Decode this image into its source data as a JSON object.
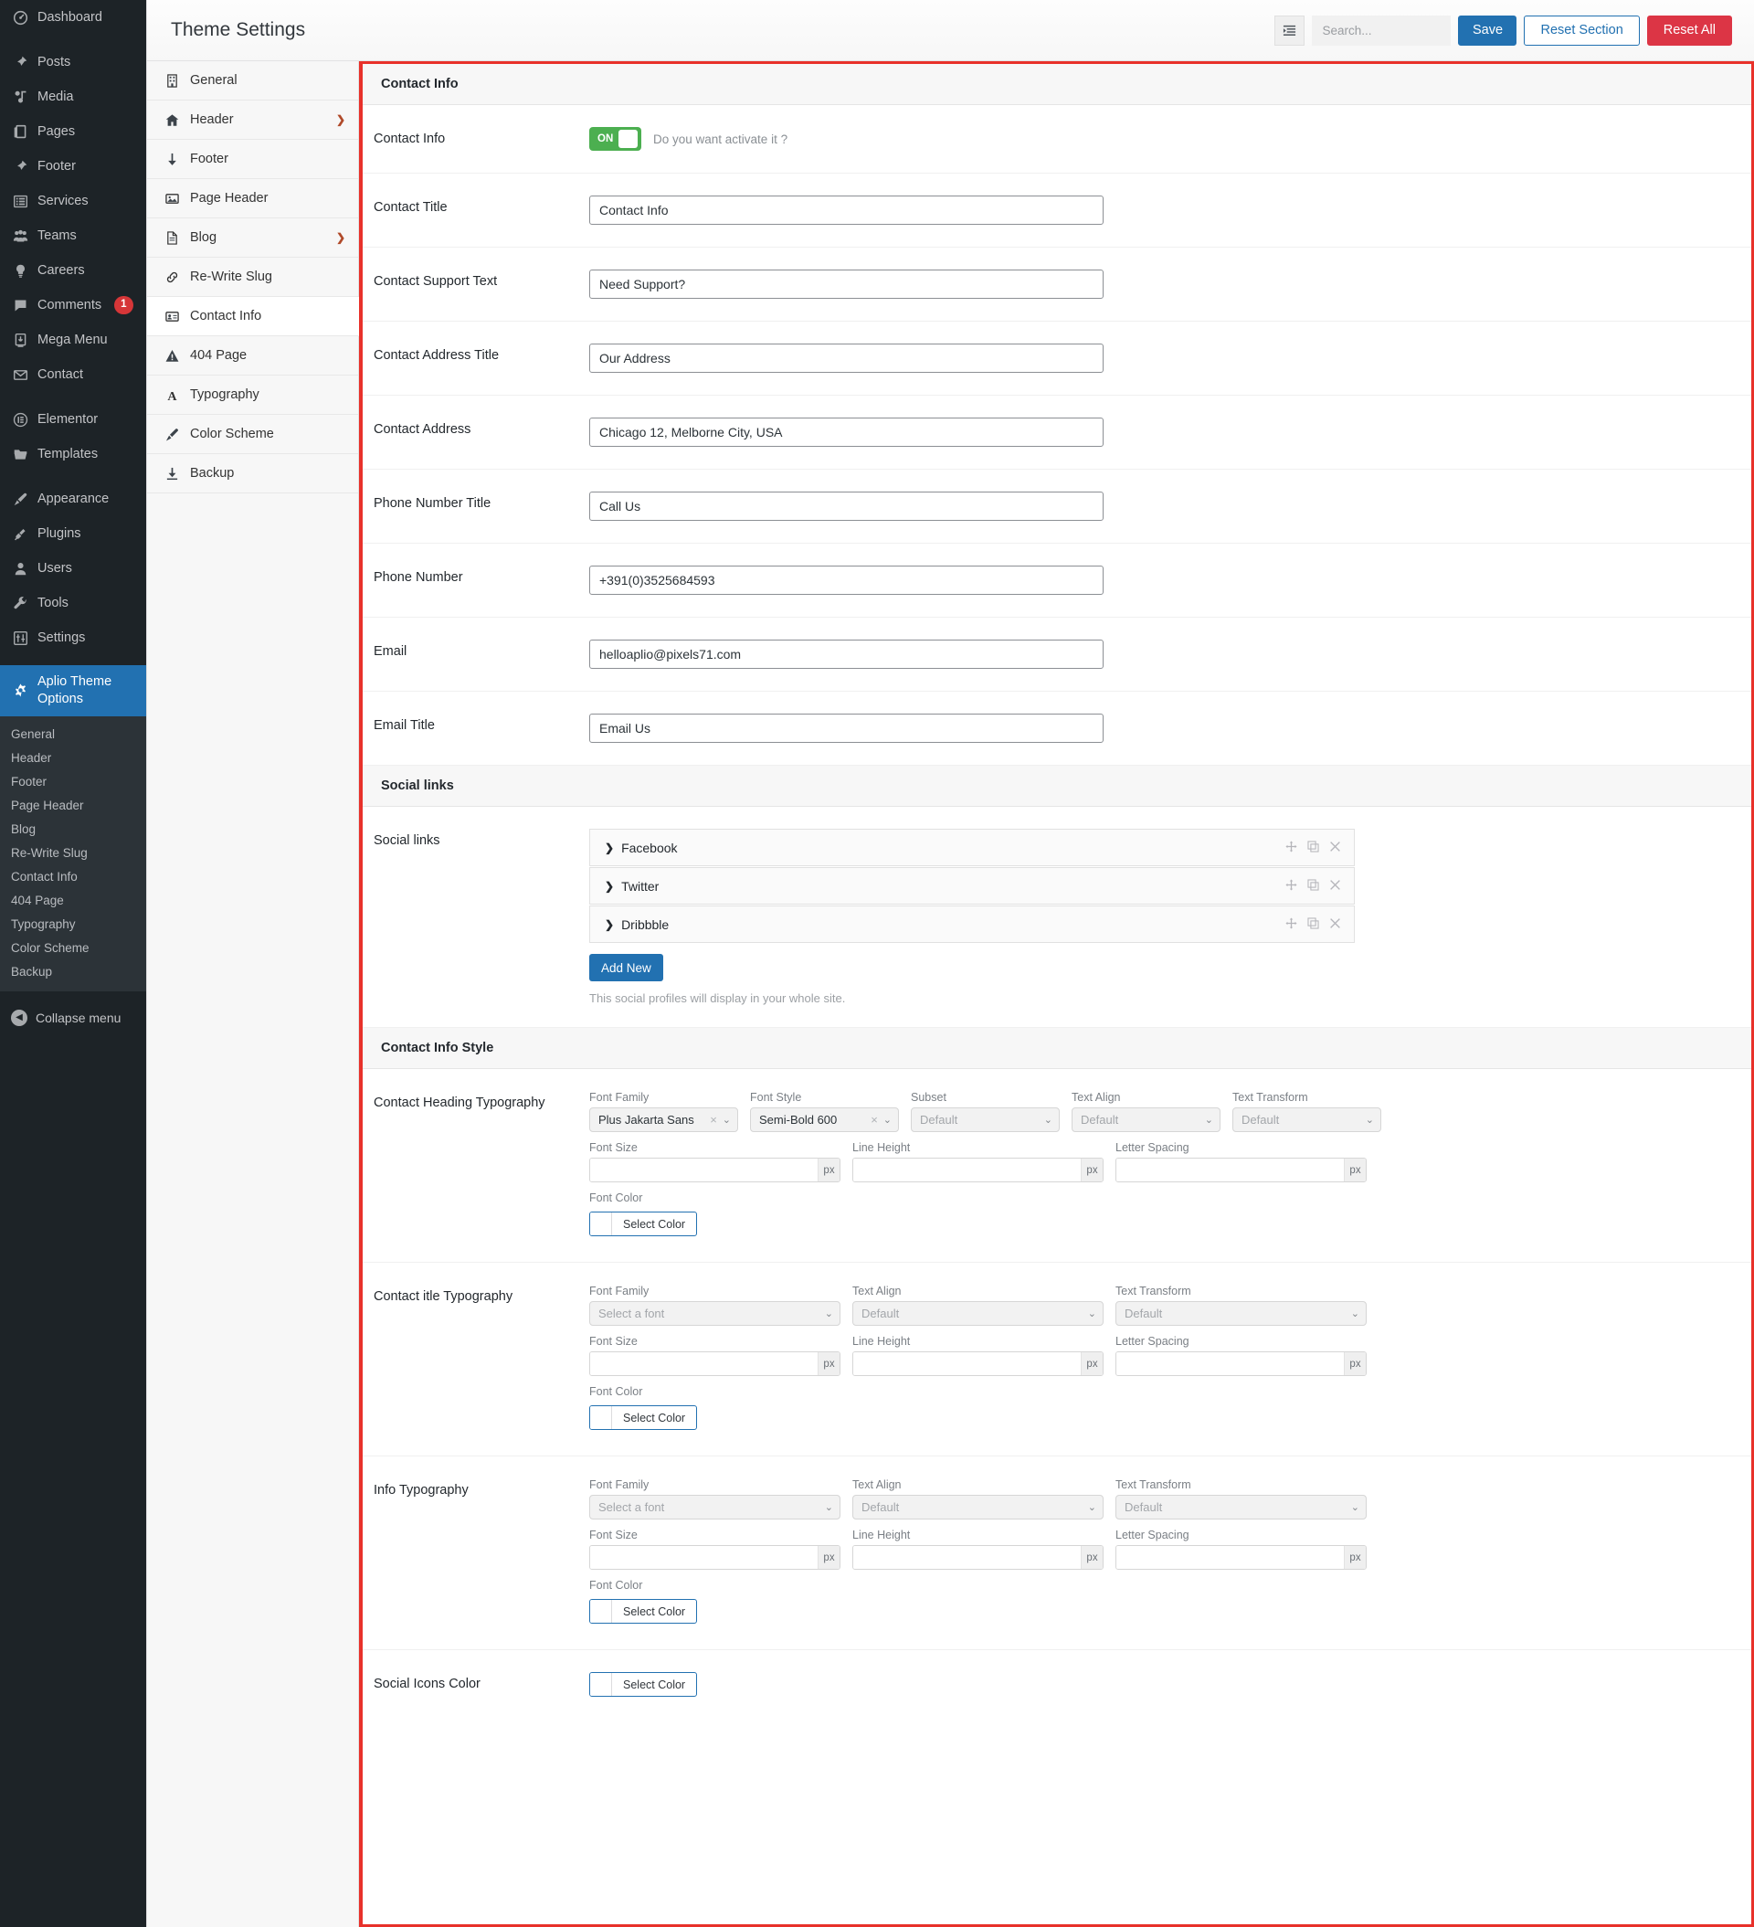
{
  "wp_sidebar": {
    "items": [
      {
        "label": "Dashboard",
        "icon": "dashboard-icon"
      },
      {
        "label": "Posts",
        "icon": "pin-icon",
        "gap_before": true
      },
      {
        "label": "Media",
        "icon": "media-icon"
      },
      {
        "label": "Pages",
        "icon": "pages-icon"
      },
      {
        "label": "Footer",
        "icon": "pin-icon"
      },
      {
        "label": "Services",
        "icon": "list-icon"
      },
      {
        "label": "Teams",
        "icon": "users-group-icon"
      },
      {
        "label": "Careers",
        "icon": "lightbulb-icon"
      },
      {
        "label": "Comments",
        "icon": "comment-icon",
        "badge": "1"
      },
      {
        "label": "Mega Menu",
        "icon": "download-box-icon"
      },
      {
        "label": "Contact",
        "icon": "envelope-icon"
      },
      {
        "label": "Elementor",
        "icon": "elementor-icon",
        "gap_before": true
      },
      {
        "label": "Templates",
        "icon": "folder-icon"
      },
      {
        "label": "Appearance",
        "icon": "brush-icon",
        "gap_before": true
      },
      {
        "label": "Plugins",
        "icon": "plug-icon"
      },
      {
        "label": "Users",
        "icon": "user-icon"
      },
      {
        "label": "Tools",
        "icon": "wrench-icon"
      },
      {
        "label": "Settings",
        "icon": "sliders-icon"
      },
      {
        "label": "Aplio Theme Options",
        "icon": "gear-icon",
        "active": true,
        "gap_before": true
      }
    ],
    "submenu": [
      "General",
      "Header",
      "Footer",
      "Page Header",
      "Blog",
      "Re-Write Slug",
      "Contact Info",
      "404 Page",
      "Typography",
      "Color Scheme",
      "Backup"
    ],
    "collapse_label": "Collapse menu"
  },
  "topbar": {
    "title": "Theme Settings",
    "search_placeholder": "Search...",
    "save_label": "Save",
    "reset_section_label": "Reset Section",
    "reset_all_label": "Reset All"
  },
  "options_nav": [
    {
      "label": "General",
      "icon": "building-icon",
      "chevron": false,
      "active": false
    },
    {
      "label": "Header",
      "icon": "home-icon",
      "chevron": true,
      "active": false
    },
    {
      "label": "Footer",
      "icon": "arrow-down-icon",
      "chevron": false,
      "active": false
    },
    {
      "label": "Page Header",
      "icon": "image-icon",
      "chevron": false,
      "active": false
    },
    {
      "label": "Blog",
      "icon": "document-icon",
      "chevron": true,
      "active": false
    },
    {
      "label": "Re-Write Slug",
      "icon": "link-icon",
      "chevron": false,
      "active": false
    },
    {
      "label": "Contact Info",
      "icon": "id-card-icon",
      "chevron": false,
      "active": true
    },
    {
      "label": "404 Page",
      "icon": "warning-icon",
      "chevron": false,
      "active": false
    },
    {
      "label": "Typography",
      "icon": "letter-a-icon",
      "chevron": false,
      "active": false
    },
    {
      "label": "Color Scheme",
      "icon": "paintbrush-icon",
      "chevron": false,
      "active": false
    },
    {
      "label": "Backup",
      "icon": "download-icon",
      "chevron": false,
      "active": false
    }
  ],
  "sections": {
    "contact_info_heading": "Contact Info",
    "social_links_heading": "Social links",
    "contact_info_style_heading": "Contact Info Style"
  },
  "contact_info": {
    "toggle": {
      "label": "Contact Info",
      "state": "ON",
      "description": "Do you want activate it ?",
      "color": "#4CAF50"
    },
    "fields": [
      {
        "label": "Contact Title",
        "value": "Contact Info"
      },
      {
        "label": "Contact Support Text",
        "value": "Need Support?"
      },
      {
        "label": "Contact Address Title",
        "value": "Our Address"
      },
      {
        "label": "Contact Address",
        "value": "Chicago 12, Melborne City, USA"
      },
      {
        "label": "Phone Number Title",
        "value": "Call Us"
      },
      {
        "label": "Phone Number",
        "value": "+391(0)3525684593"
      },
      {
        "label": "Email",
        "value": "helloaplio@pixels71.com"
      },
      {
        "label": "Email Title",
        "value": "Email Us"
      }
    ]
  },
  "social_links": {
    "label": "Social links",
    "items": [
      {
        "name": "Facebook"
      },
      {
        "name": "Twitter"
      },
      {
        "name": "Dribbble"
      }
    ],
    "add_new_label": "Add New",
    "hint": "This social profiles will display in your whole site.",
    "action_icons": [
      "move-icon",
      "duplicate-icon",
      "close-icon"
    ]
  },
  "labels": {
    "font_family": "Font Family",
    "font_style": "Font Style",
    "subset": "Subset",
    "text_align": "Text Align",
    "text_transform": "Text Transform",
    "font_size": "Font Size",
    "line_height": "Line Height",
    "letter_spacing": "Letter Spacing",
    "font_color": "Font Color",
    "select_color": "Select Color",
    "select_a_font": "Select a font",
    "default": "Default",
    "px": "px"
  },
  "typography_blocks": [
    {
      "label": "Contact Heading Typography",
      "has_font_style": true,
      "has_subset": true,
      "font_family": "Plus Jakarta Sans",
      "font_style": "Semi-Bold 600",
      "subset": "Default",
      "text_align": "Default",
      "text_transform": "Default",
      "font_size": "",
      "line_height": "",
      "letter_spacing": "",
      "font_color": "Select Color"
    },
    {
      "label": "Contact itle Typography",
      "has_font_style": false,
      "has_subset": false,
      "font_family": "Select a font",
      "text_align": "Default",
      "text_transform": "Default",
      "font_size": "",
      "line_height": "",
      "letter_spacing": "",
      "font_color": "Select Color"
    },
    {
      "label": "Info Typography",
      "has_font_style": false,
      "has_subset": false,
      "font_family": "Select a font",
      "text_align": "Default",
      "text_transform": "Default",
      "font_size": "",
      "line_height": "",
      "letter_spacing": "",
      "font_color": "Select Color"
    }
  ],
  "social_icons_color": {
    "label": "Social Icons Color",
    "button_label": "Select Color"
  },
  "colors": {
    "wp_sidebar_bg": "#1d2327",
    "wp_submenu_bg": "#2c3338",
    "accent_blue": "#2271b1",
    "danger_red": "#dc3545",
    "toggle_green": "#4CAF50",
    "highlight_border": "#e8312a",
    "badge_red": "#d63638"
  }
}
